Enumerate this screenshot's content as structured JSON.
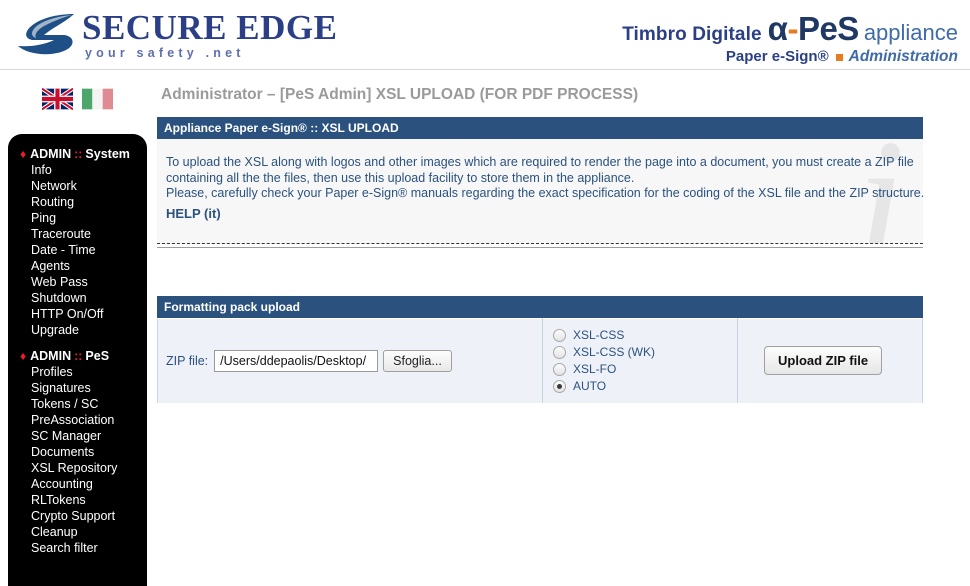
{
  "header": {
    "logo_title": "SECURE EDGE",
    "logo_subtitle": "your safety .net",
    "brand_timbro": "Timbro Digitale",
    "brand_apes_alpha": "α",
    "brand_apes_dash": "-",
    "brand_apes_pes": "PeS",
    "brand_appliance": "appliance",
    "brand_paper": "Paper e-Sign®",
    "brand_admin": "Administration"
  },
  "flags": [
    {
      "name": "flag-en",
      "title": "English"
    },
    {
      "name": "flag-it",
      "title": "Italiano"
    }
  ],
  "page_title": "Administrator – [PeS Admin] XSL UPLOAD (FOR PDF PROCESS)",
  "info_panel": {
    "heading": "Appliance Paper e-Sign® :: XSL UPLOAD",
    "watermark": "i",
    "lines": [
      "To upload the XSL along with logos and other images which are required to render the page into a document, you must create a ZIP file",
      "containing all the the files, then use this upload facility to store them in the appliance.",
      "Please, carefully check your Paper e-Sign® manuals regarding the exact specification for the coding of the XSL file and the ZIP structure."
    ],
    "help_link": "HELP (it)"
  },
  "form_panel": {
    "heading": "Formatting pack upload",
    "file_label": "ZIP file:",
    "file_value": "/Users/ddepaolis/Desktop/",
    "file_placeholder": "",
    "browse_label": "Sfoglia...",
    "radio_options": [
      {
        "label": "XSL-CSS",
        "checked": false
      },
      {
        "label": "XSL-CSS (WK)",
        "checked": false
      },
      {
        "label": "XSL-FO",
        "checked": false
      },
      {
        "label": "AUTO",
        "checked": true
      }
    ],
    "submit_label": "Upload ZIP file"
  },
  "sidebar": {
    "groups": [
      {
        "admin_word": "ADMIN",
        "separator": "::",
        "name": "System",
        "items": [
          "Info",
          "Network",
          "Routing",
          "Ping",
          "Traceroute",
          "Date - Time",
          "Agents",
          "Web Pass",
          "Shutdown",
          "HTTP On/Off",
          "Upgrade"
        ]
      },
      {
        "admin_word": "ADMIN",
        "separator": "::",
        "name": "PeS",
        "items": [
          "Profiles",
          "Signatures",
          "Tokens / SC",
          "PreAssociation",
          "SC Manager",
          "Documents",
          "XSL Repository",
          "Accounting",
          "RLTokens",
          "Crypto Support",
          "Cleanup",
          "Search filter"
        ]
      }
    ]
  },
  "colors": {
    "panel_header": "#2b527f",
    "accent_red": "#ee1c25",
    "accent_orange": "#e87a22",
    "link_blue": "#2b527f",
    "title_gray": "#9a9a9a",
    "sidebar_bg": "#000000",
    "form_bg": "#eef2f8",
    "info_bg": "#f7f7f7"
  }
}
